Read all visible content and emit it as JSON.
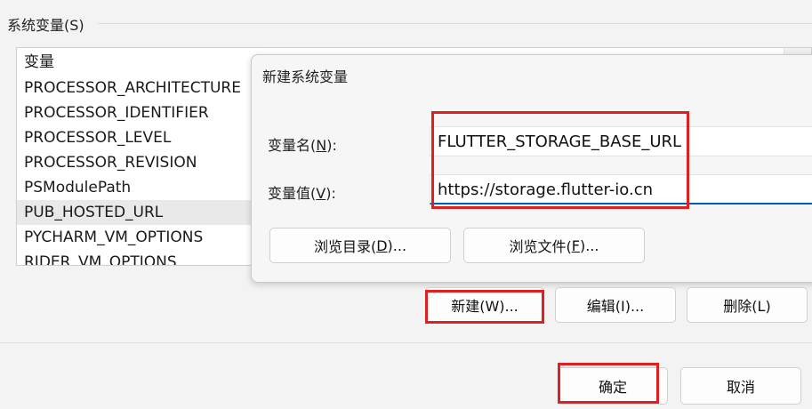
{
  "group": {
    "title": "系统变量(S)"
  },
  "var_list": {
    "items": [
      "变量",
      "PROCESSOR_ARCHITECTURE",
      "PROCESSOR_IDENTIFIER",
      "PROCESSOR_LEVEL",
      "PROCESSOR_REVISION",
      "PSModulePath",
      "PUB_HOSTED_URL",
      "PYCHARM_VM_OPTIONS",
      "RIDER_VM_OPTIONS"
    ],
    "selected": "PUB_HOSTED_URL"
  },
  "dialog": {
    "title": "新建系统变量",
    "name_label": {
      "pre": "变量名(",
      "key": "N",
      "post": "):"
    },
    "name_value": "FLUTTER_STORAGE_BASE_URL",
    "value_label": {
      "pre": "变量值(",
      "key": "V",
      "post": "):"
    },
    "value_value": "https://storage.flutter-io.cn",
    "browse_dir": {
      "pre": "浏览目录(",
      "key": "D",
      "post": ")..."
    },
    "browse_file": {
      "pre": "浏览文件(",
      "key": "F",
      "post": ")..."
    }
  },
  "buttons": {
    "new": "新建(W)...",
    "edit": "编辑(I)...",
    "delete": "删除(L)",
    "ok": "确定",
    "cancel": "取消"
  },
  "colors": {
    "highlight": "#e02020",
    "focus_underline": "#005fb8"
  }
}
